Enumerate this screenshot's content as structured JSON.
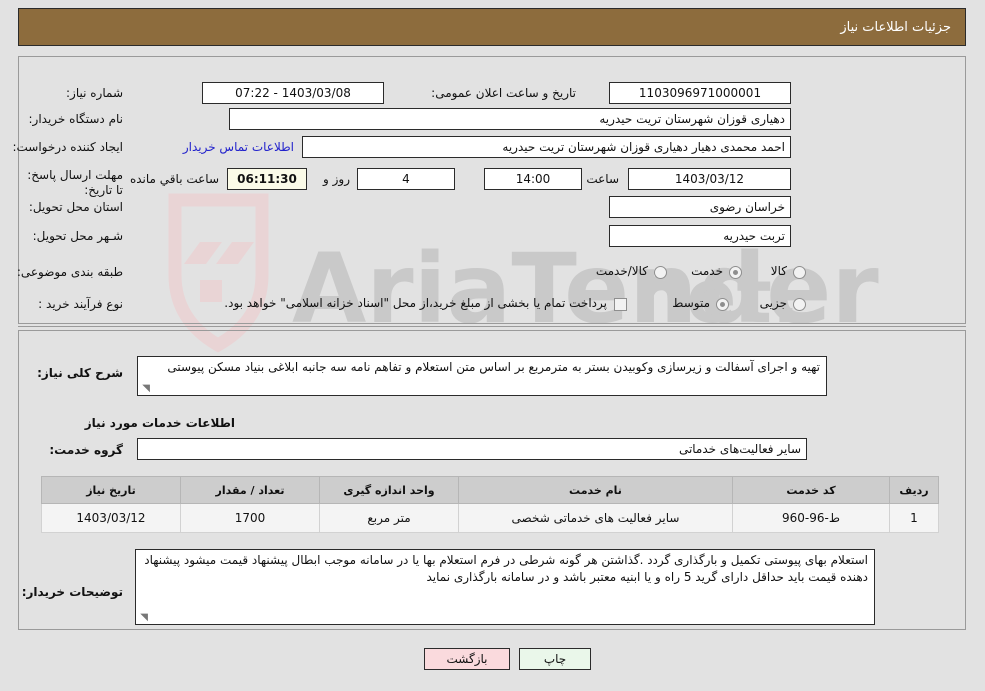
{
  "header": {
    "title": "جزئیات اطلاعات نیاز"
  },
  "form": {
    "need_number_label": "شماره نیاز:",
    "need_number_value": "1103096971000001",
    "announce_datetime_label": "تاریخ و ساعت اعلان عمومی:",
    "announce_datetime_value": "1403/03/08 - 07:22",
    "buyer_org_label": "نام دستگاه خریدار:",
    "buyer_org_value": "دهیاری قوزان  شهرستان تریت حیدریه",
    "requester_label": "ایجاد کننده درخواست:",
    "requester_value": "احمد محمدی دهیار دهیاری قوزان  شهرستان تریت حیدریه",
    "contact_link": "اطلاعات تماس خریدار",
    "deadline_label": "مهلت ارسال پاسخ: تا تاریخ:",
    "deadline_date": "1403/03/12",
    "hour_label": "ساعت",
    "deadline_time": "14:00",
    "days_value": "4",
    "days_and_label": "روز و",
    "countdown_value": "06:11:30",
    "remaining_label": "ساعت باقي مانده",
    "province_label": "استان محل تحویل:",
    "province_value": "خراسان رضوی",
    "city_label": "شـهر محل تحویل:",
    "city_value": "تربت حیدریه",
    "category_label": "طبقه بندی موضوعی:",
    "category_options": [
      "کالا",
      "خدمت",
      "کالا/خدمت"
    ],
    "category_selected": "خدمت",
    "process_label": "نوع فرآیند خرید :",
    "process_options": [
      "جزیی",
      "متوسط"
    ],
    "process_selected": "متوسط",
    "treasury_note": "پرداخت تمام یا بخشی از مبلغ خرید،از محل \"اسناد خزانه اسلامی\" خواهد بود.",
    "treasury_checked": false
  },
  "description": {
    "label": "شرح کلی نیاز:",
    "value": "تهیه و اجرای آسفالت و زیرسازی وکوبیدن بستر به مترمربع بر اساس متن استعلام و تفاهم نامه سه جانبه ابلاغی بنیاد مسکن پیوستی"
  },
  "services_section": {
    "title": "اطلاعات خدمات مورد نیاز",
    "group_label": "گروه خدمت:",
    "group_value": "سایر فعالیت‌های خدماتی"
  },
  "table": {
    "columns": [
      "ردیف",
      "کد خدمت",
      "نام خدمت",
      "واحد اندازه گیری",
      "تعداد / مقدار",
      "تاریخ نیاز"
    ],
    "rows": [
      {
        "row": "1",
        "code": "ط-96-960",
        "name": "سایر فعالیت های خدماتی شخصی",
        "unit": "متر مربع",
        "qty": "1700",
        "date": "1403/03/12"
      }
    ]
  },
  "notes": {
    "label": "توضیحات خریدار:",
    "value": "استعلام بهای پیوستی تکمیل و بارگذاری گردد .گذاشتن هر گونه شرطی در فرم استعلام بها یا در سامانه موجب ابطال پیشنهاد قیمت میشود پیشنهاد دهنده قیمت باید حداقل دارای گرید 5 راه و یا ابنیه معتبر باشد و در سامانه بارگذاری نماید"
  },
  "buttons": {
    "print": "چاپ",
    "back": "بازگشت"
  },
  "watermark": {
    "text": "AriaTender",
    "suffix": ".net"
  },
  "colors": {
    "header_bg": "#8d6c3d",
    "link": "#2222cc",
    "print_btn": "#eaf7ea",
    "back_btn": "#fadadd"
  }
}
